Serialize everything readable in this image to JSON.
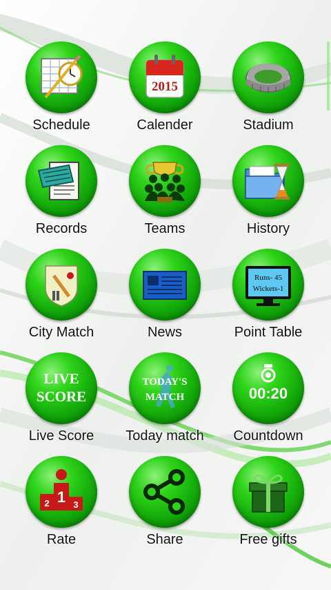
{
  "tiles": [
    {
      "label": "Schedule",
      "icon": "schedule-icon"
    },
    {
      "label": "Calender",
      "icon": "calendar-icon",
      "icon_text": "2015"
    },
    {
      "label": "Stadium",
      "icon": "stadium-icon"
    },
    {
      "label": "Records",
      "icon": "records-icon"
    },
    {
      "label": "Teams",
      "icon": "teams-icon"
    },
    {
      "label": "History",
      "icon": "history-icon"
    },
    {
      "label": "City Match",
      "icon": "city-match-icon"
    },
    {
      "label": "News",
      "icon": "news-icon"
    },
    {
      "label": "Point Table",
      "icon": "point-table-icon",
      "icon_text_1": "Runs- 45",
      "icon_text_2": "Wickets-1"
    },
    {
      "label": "Live Score",
      "icon": "live-score-icon",
      "icon_text_1": "LIVE",
      "icon_text_2": "SCORE"
    },
    {
      "label": "Today match",
      "icon": "today-match-icon",
      "icon_text_1": "TODAY'S",
      "icon_text_2": "MATCH"
    },
    {
      "label": "Countdown",
      "icon": "countdown-icon",
      "icon_text": "00:20"
    },
    {
      "label": "Rate",
      "icon": "rate-podium-icon",
      "podium": [
        "2",
        "1",
        "3"
      ]
    },
    {
      "label": "Share",
      "icon": "share-icon"
    },
    {
      "label": "Free gifts",
      "icon": "gift-icon"
    }
  ],
  "colors": {
    "accent_green": "#13a90a",
    "background": "#f4f6f4"
  }
}
